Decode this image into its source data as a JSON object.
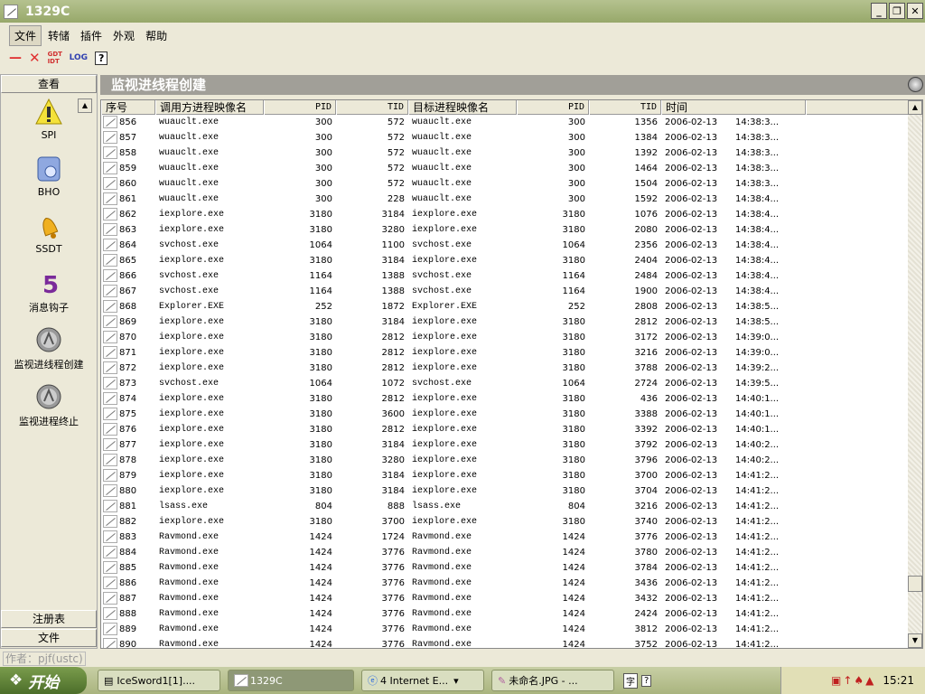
{
  "window": {
    "title": "1329C"
  },
  "menu": [
    "文件",
    "转储",
    "插件",
    "外观",
    "帮助"
  ],
  "toolbar": {
    "minus": "—",
    "close": "✕",
    "gdt": "GDT IDT",
    "log": "LOG",
    "help": "?"
  },
  "sidebar": {
    "header": "查看",
    "items": [
      "SPI",
      "BHO",
      "SSDT",
      "消息钩子",
      "监视进线程创建",
      "监视进程终止"
    ],
    "footer": [
      "注册表",
      "文件"
    ]
  },
  "panel": {
    "title": "监视进线程创建"
  },
  "columns": [
    "序号",
    "调用方进程映像名",
    "PID",
    "TID",
    "目标进程映像名",
    "PID",
    "TID",
    "时间"
  ],
  "rows": [
    [
      "856",
      "wuauclt.exe",
      "300",
      "572",
      "wuauclt.exe",
      "300",
      "1356",
      "2006-02-13",
      "14:38:3..."
    ],
    [
      "857",
      "wuauclt.exe",
      "300",
      "572",
      "wuauclt.exe",
      "300",
      "1384",
      "2006-02-13",
      "14:38:3..."
    ],
    [
      "858",
      "wuauclt.exe",
      "300",
      "572",
      "wuauclt.exe",
      "300",
      "1392",
      "2006-02-13",
      "14:38:3..."
    ],
    [
      "859",
      "wuauclt.exe",
      "300",
      "572",
      "wuauclt.exe",
      "300",
      "1464",
      "2006-02-13",
      "14:38:3..."
    ],
    [
      "860",
      "wuauclt.exe",
      "300",
      "572",
      "wuauclt.exe",
      "300",
      "1504",
      "2006-02-13",
      "14:38:3..."
    ],
    [
      "861",
      "wuauclt.exe",
      "300",
      "228",
      "wuauclt.exe",
      "300",
      "1592",
      "2006-02-13",
      "14:38:4..."
    ],
    [
      "862",
      "iexplore.exe",
      "3180",
      "3184",
      "iexplore.exe",
      "3180",
      "1076",
      "2006-02-13",
      "14:38:4..."
    ],
    [
      "863",
      "iexplore.exe",
      "3180",
      "3280",
      "iexplore.exe",
      "3180",
      "2080",
      "2006-02-13",
      "14:38:4..."
    ],
    [
      "864",
      "svchost.exe",
      "1064",
      "1100",
      "svchost.exe",
      "1064",
      "2356",
      "2006-02-13",
      "14:38:4..."
    ],
    [
      "865",
      "iexplore.exe",
      "3180",
      "3184",
      "iexplore.exe",
      "3180",
      "2404",
      "2006-02-13",
      "14:38:4..."
    ],
    [
      "866",
      "svchost.exe",
      "1164",
      "1388",
      "svchost.exe",
      "1164",
      "2484",
      "2006-02-13",
      "14:38:4..."
    ],
    [
      "867",
      "svchost.exe",
      "1164",
      "1388",
      "svchost.exe",
      "1164",
      "1900",
      "2006-02-13",
      "14:38:4..."
    ],
    [
      "868",
      "Explorer.EXE",
      "252",
      "1872",
      "Explorer.EXE",
      "252",
      "2808",
      "2006-02-13",
      "14:38:5..."
    ],
    [
      "869",
      "iexplore.exe",
      "3180",
      "3184",
      "iexplore.exe",
      "3180",
      "2812",
      "2006-02-13",
      "14:38:5..."
    ],
    [
      "870",
      "iexplore.exe",
      "3180",
      "2812",
      "iexplore.exe",
      "3180",
      "3172",
      "2006-02-13",
      "14:39:0..."
    ],
    [
      "871",
      "iexplore.exe",
      "3180",
      "2812",
      "iexplore.exe",
      "3180",
      "3216",
      "2006-02-13",
      "14:39:0..."
    ],
    [
      "872",
      "iexplore.exe",
      "3180",
      "2812",
      "iexplore.exe",
      "3180",
      "3788",
      "2006-02-13",
      "14:39:2..."
    ],
    [
      "873",
      "svchost.exe",
      "1064",
      "1072",
      "svchost.exe",
      "1064",
      "2724",
      "2006-02-13",
      "14:39:5..."
    ],
    [
      "874",
      "iexplore.exe",
      "3180",
      "2812",
      "iexplore.exe",
      "3180",
      "436",
      "2006-02-13",
      "14:40:1..."
    ],
    [
      "875",
      "iexplore.exe",
      "3180",
      "3600",
      "iexplore.exe",
      "3180",
      "3388",
      "2006-02-13",
      "14:40:1..."
    ],
    [
      "876",
      "iexplore.exe",
      "3180",
      "2812",
      "iexplore.exe",
      "3180",
      "3392",
      "2006-02-13",
      "14:40:1..."
    ],
    [
      "877",
      "iexplore.exe",
      "3180",
      "3184",
      "iexplore.exe",
      "3180",
      "3792",
      "2006-02-13",
      "14:40:2..."
    ],
    [
      "878",
      "iexplore.exe",
      "3180",
      "3280",
      "iexplore.exe",
      "3180",
      "3796",
      "2006-02-13",
      "14:40:2..."
    ],
    [
      "879",
      "iexplore.exe",
      "3180",
      "3184",
      "iexplore.exe",
      "3180",
      "3700",
      "2006-02-13",
      "14:41:2..."
    ],
    [
      "880",
      "iexplore.exe",
      "3180",
      "3184",
      "iexplore.exe",
      "3180",
      "3704",
      "2006-02-13",
      "14:41:2..."
    ],
    [
      "881",
      "lsass.exe",
      "804",
      "888",
      "lsass.exe",
      "804",
      "3216",
      "2006-02-13",
      "14:41:2..."
    ],
    [
      "882",
      "iexplore.exe",
      "3180",
      "3700",
      "iexplore.exe",
      "3180",
      "3740",
      "2006-02-13",
      "14:41:2..."
    ],
    [
      "883",
      "Ravmond.exe",
      "1424",
      "1724",
      "Ravmond.exe",
      "1424",
      "3776",
      "2006-02-13",
      "14:41:2..."
    ],
    [
      "884",
      "Ravmond.exe",
      "1424",
      "3776",
      "Ravmond.exe",
      "1424",
      "3780",
      "2006-02-13",
      "14:41:2..."
    ],
    [
      "885",
      "Ravmond.exe",
      "1424",
      "3776",
      "Ravmond.exe",
      "1424",
      "3784",
      "2006-02-13",
      "14:41:2..."
    ],
    [
      "886",
      "Ravmond.exe",
      "1424",
      "3776",
      "Ravmond.exe",
      "1424",
      "3436",
      "2006-02-13",
      "14:41:2..."
    ],
    [
      "887",
      "Ravmond.exe",
      "1424",
      "3776",
      "Ravmond.exe",
      "1424",
      "3432",
      "2006-02-13",
      "14:41:2..."
    ],
    [
      "888",
      "Ravmond.exe",
      "1424",
      "3776",
      "Ravmond.exe",
      "1424",
      "2424",
      "2006-02-13",
      "14:41:2..."
    ],
    [
      "889",
      "Ravmond.exe",
      "1424",
      "3776",
      "Ravmond.exe",
      "1424",
      "3812",
      "2006-02-13",
      "14:41:2..."
    ],
    [
      "890",
      "Ravmond.exe",
      "1424",
      "3776",
      "Ravmond.exe",
      "1424",
      "3752",
      "2006-02-13",
      "14:41:2..."
    ]
  ],
  "status": "作者：pjf(ustc)",
  "taskbar": {
    "start": "开始",
    "tasks": [
      "IceSword1[1]....",
      "1329C",
      "4 Internet E...",
      "未命名.JPG - ..."
    ],
    "clock": "15:21"
  }
}
